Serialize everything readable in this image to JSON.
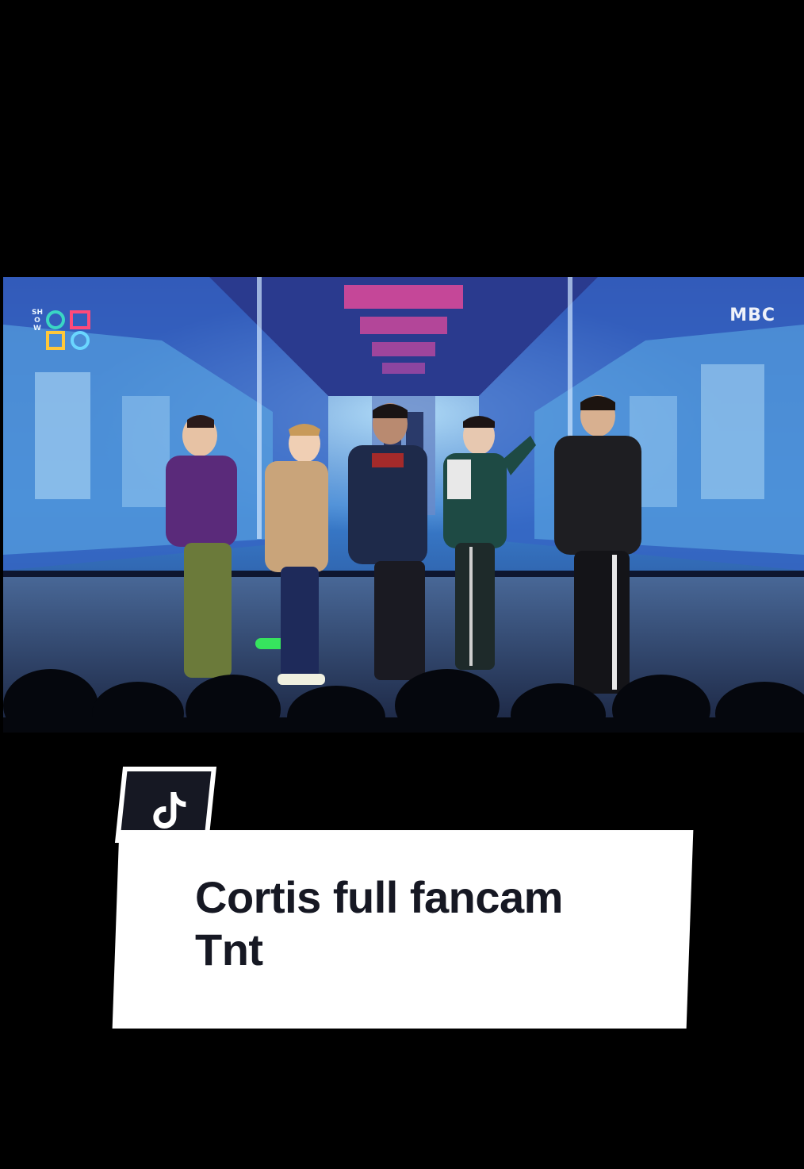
{
  "video": {
    "show_logo_word": "SHOW",
    "broadcaster_logo": "MBC"
  },
  "tiktok_badge": {
    "icon": "tiktok-note-icon"
  },
  "caption": {
    "line1": "Cortis full fancam",
    "line2": "Tnt"
  },
  "colors": {
    "background": "#000000",
    "caption_bg": "#ffffff",
    "caption_text": "#161823",
    "badge_bg": "#161823"
  }
}
